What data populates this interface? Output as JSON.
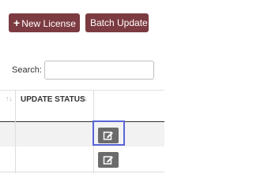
{
  "toolbar": {
    "new_license_icon": "plus-icon",
    "new_license_label": "New License",
    "batch_update_label": "Batch Update"
  },
  "search": {
    "label": "Search:",
    "value": "",
    "placeholder": ""
  },
  "table": {
    "columns": [
      {
        "label": "UPDATE STATUS",
        "sort_icon": "sort-icon"
      }
    ],
    "rows": [
      {
        "action_icon": "edit-icon"
      },
      {
        "action_icon": "edit-icon"
      }
    ]
  },
  "colors": {
    "button_bg": "#7c3b41",
    "edit_button_bg": "#6b6b6b",
    "focus_outline": "#5865d8",
    "striped_row": "#f2f2f2"
  }
}
